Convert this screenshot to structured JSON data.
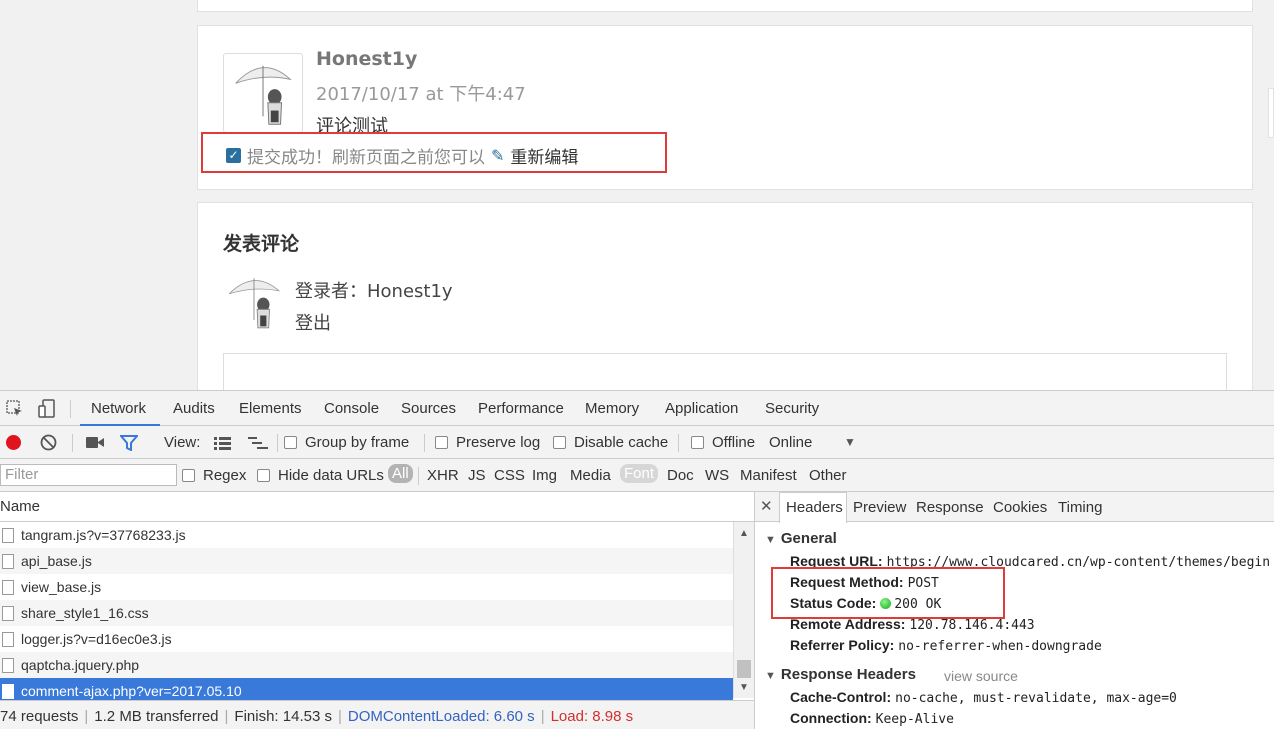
{
  "comment": {
    "author": "Honest1y",
    "date": "2017/10/17 at 下午4:47",
    "text": "评论测试",
    "notice": "提交成功！刷新页面之前您可以",
    "edit_link": "重新编辑"
  },
  "post_form": {
    "title": "发表评论",
    "logged_in": "登录者：Honest1y",
    "logout": "登出"
  },
  "devtools": {
    "tabs": [
      "Network",
      "Audits",
      "Elements",
      "Console",
      "Sources",
      "Performance",
      "Memory",
      "Application",
      "Security"
    ],
    "toolbar": {
      "view_label": "View:",
      "group_by_frame": "Group by frame",
      "preserve_log": "Preserve log",
      "disable_cache": "Disable cache",
      "offline": "Offline",
      "throttle": "Online"
    },
    "filter": {
      "placeholder": "Filter",
      "regex": "Regex",
      "hide_data_urls": "Hide data URLs",
      "types": [
        "All",
        "XHR",
        "JS",
        "CSS",
        "Img",
        "Media",
        "Font",
        "Doc",
        "WS",
        "Manifest",
        "Other"
      ]
    },
    "list": {
      "header": "Name",
      "rows": [
        "tangram.js?v=37768233.js",
        "api_base.js",
        "view_base.js",
        "share_style1_16.css",
        "logger.js?v=d16ec0e3.js",
        "qaptcha.jquery.php",
        "comment-ajax.php?ver=2017.05.10"
      ]
    },
    "status": {
      "requests": "74 requests",
      "transferred": "1.2 MB transferred",
      "finish": "Finish: 14.53 s",
      "dom_loaded": "DOMContentLoaded: 6.60 s",
      "load": "Load: 8.98 s"
    },
    "detail": {
      "tabs": [
        "Headers",
        "Preview",
        "Response",
        "Cookies",
        "Timing"
      ],
      "general_label": "General",
      "request_url_key": "Request URL:",
      "request_url": "https://www.cloudcared.cn/wp-content/themes/begin",
      "request_method_key": "Request Method:",
      "request_method": "POST",
      "status_code_key": "Status Code:",
      "status_code": "200 OK",
      "remote_address_key": "Remote Address:",
      "remote_address": "120.78.146.4:443",
      "referrer_policy_key": "Referrer Policy:",
      "referrer_policy": "no-referrer-when-downgrade",
      "response_headers_label": "Response Headers",
      "view_source": "view source",
      "cache_control_key": "Cache-Control:",
      "cache_control": "no-cache, must-revalidate, max-age=0",
      "connection_key": "Connection:",
      "connection": "Keep-Alive"
    }
  }
}
